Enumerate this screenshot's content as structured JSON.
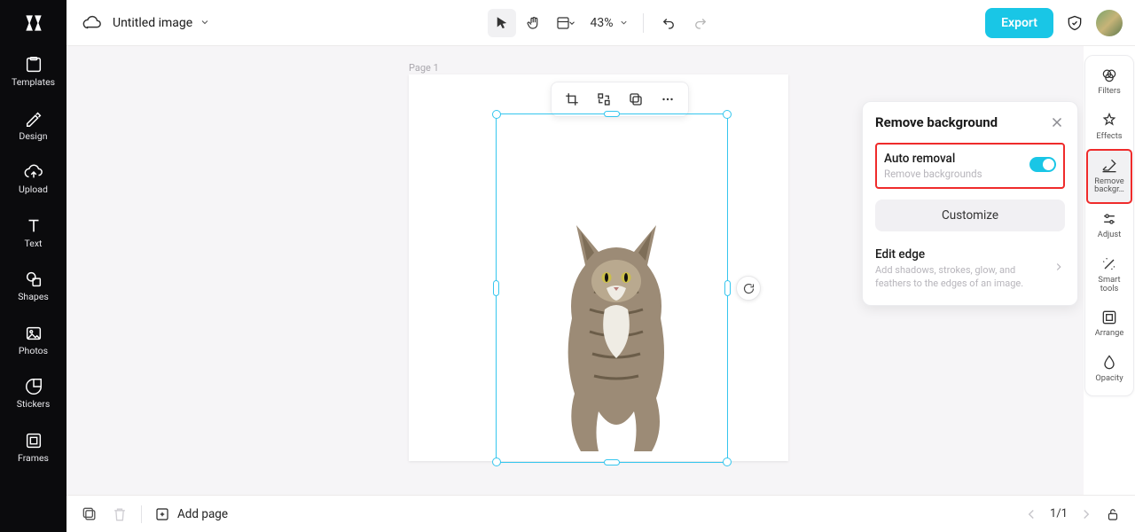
{
  "header": {
    "title": "Untitled image",
    "zoom": "43%",
    "export_label": "Export"
  },
  "left_sidebar": {
    "items": [
      {
        "label": "Templates"
      },
      {
        "label": "Design"
      },
      {
        "label": "Upload"
      },
      {
        "label": "Text"
      },
      {
        "label": "Shapes"
      },
      {
        "label": "Photos"
      },
      {
        "label": "Stickers"
      },
      {
        "label": "Frames"
      }
    ]
  },
  "canvas": {
    "page_label": "Page 1"
  },
  "right_tools": {
    "items": [
      {
        "label": "Filters"
      },
      {
        "label": "Effects"
      },
      {
        "label": "Remove backgr…"
      },
      {
        "label": "Adjust"
      },
      {
        "label": "Smart tools"
      },
      {
        "label": "Arrange"
      },
      {
        "label": "Opacity"
      }
    ]
  },
  "remove_bg_panel": {
    "title": "Remove background",
    "auto_title": "Auto removal",
    "auto_sub": "Remove backgrounds",
    "auto_on": true,
    "customize_label": "Customize",
    "edit_edge_title": "Edit edge",
    "edit_edge_sub": "Add shadows, strokes, glow, and feathers to the edges of an image."
  },
  "bottom": {
    "add_page_label": "Add page",
    "page_indicator": "1/1"
  },
  "annotations": {
    "right_tool_highlight_index": 2,
    "auto_removal_highlight": true
  }
}
